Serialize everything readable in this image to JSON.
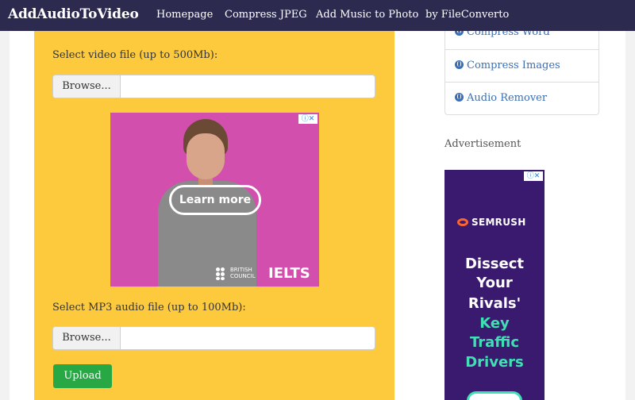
{
  "navbar": {
    "brand": "AddAudioToVideo",
    "links": [
      "Homepage",
      "Compress JPEG",
      "Add Music to Photo",
      "by FileConverto"
    ]
  },
  "form": {
    "video_label": "Select video file (up to 500Mb):",
    "audio_label": "Select MP3 audio file (up to 100Mb):",
    "browse_label": "Browse...",
    "upload_label": "Upload"
  },
  "ad1": {
    "cta": "Learn more",
    "brand_line1": "BRITISH",
    "brand_line2": "COUNCIL",
    "product": "IELTS"
  },
  "sidebar": {
    "items": [
      {
        "label": "Compress Word",
        "icon": "globe-icon"
      },
      {
        "label": "Compress Images",
        "icon": "globe-icon"
      },
      {
        "label": "Audio Remover",
        "icon": "globe-icon"
      }
    ],
    "ad_label": "Advertisement"
  },
  "ad2": {
    "brand": "SEMRUSH",
    "lines": [
      "Dissect",
      "Your",
      "Rivals'",
      "Key",
      "Traffic",
      "Drivers"
    ]
  },
  "colors": {
    "navbar": "#2d2a4f",
    "panel": "#fdca3d",
    "upload_button": "#28a745",
    "link": "#3a6fb3"
  }
}
